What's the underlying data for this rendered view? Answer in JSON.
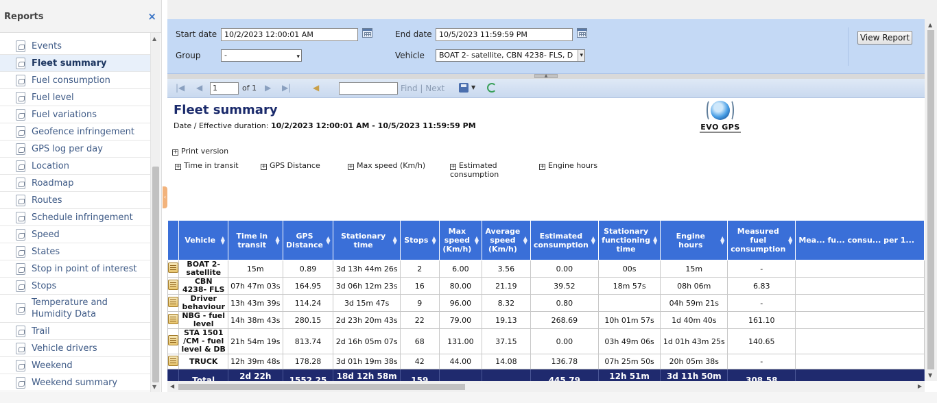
{
  "sidebar": {
    "title": "Reports",
    "close_glyph": "×",
    "items": [
      {
        "label": "Events",
        "active": false
      },
      {
        "label": "Fleet summary",
        "active": true
      },
      {
        "label": "Fuel consumption",
        "active": false
      },
      {
        "label": "Fuel level",
        "active": false
      },
      {
        "label": "Fuel variations",
        "active": false
      },
      {
        "label": "Geofence infringement",
        "active": false
      },
      {
        "label": "GPS log per day",
        "active": false
      },
      {
        "label": "Location",
        "active": false
      },
      {
        "label": "Roadmap",
        "active": false
      },
      {
        "label": "Routes",
        "active": false
      },
      {
        "label": "Schedule infringement",
        "active": false
      },
      {
        "label": "Speed",
        "active": false
      },
      {
        "label": "States",
        "active": false
      },
      {
        "label": "Stop in point of interest",
        "active": false
      },
      {
        "label": "Stops",
        "active": false
      },
      {
        "label": "Temperature and Humidity Data",
        "active": false
      },
      {
        "label": "Trail",
        "active": false
      },
      {
        "label": "Vehicle drivers",
        "active": false
      },
      {
        "label": "Weekend",
        "active": false
      },
      {
        "label": "Weekend summary",
        "active": false
      }
    ]
  },
  "params": {
    "start_label": "Start date",
    "start_value": "10/2/2023 12:00:01 AM",
    "end_label": "End date",
    "end_value": "10/5/2023 11:59:59 PM",
    "group_label": "Group",
    "group_value": "-",
    "vehicle_label": "Vehicle",
    "vehicle_value": "BOAT 2- satellite, CBN 4238- FLS, D",
    "view_button": "View Report"
  },
  "toolbar": {
    "page_value": "1",
    "of_text": "of 1",
    "find_label": "Find",
    "separator": "|",
    "next_label": "Next"
  },
  "report": {
    "title": "Fleet summary",
    "sub_label": "Date / Effective duration:",
    "sub_value": "10/2/2023 12:00:01 AM - 10/5/2023 11:59:59 PM",
    "logo_text": "EVO GPS",
    "print_version": "Print version",
    "toggles": [
      "Time in transit",
      "GPS Distance",
      "Max speed (Km/h)",
      "Estimated consumption",
      "Engine hours"
    ]
  },
  "table": {
    "headers": [
      "Vehicle",
      "Time in transit",
      "GPS Distance",
      "Stationary time",
      "Stops",
      "Max speed (Km/h)",
      "Average speed (Km/h)",
      "Estimated consumption",
      "Stationary functioning time",
      "Engine hours",
      "Measured fuel consumption",
      "Mea... fu... consu... per 1..."
    ],
    "rows": [
      [
        "BOAT 2- satellite",
        "15m",
        "0.89",
        "3d 13h 44m 26s",
        "2",
        "6.00",
        "3.56",
        "0.00",
        "00s",
        "15m",
        "-",
        ""
      ],
      [
        "CBN 4238- FLS",
        "07h 47m 03s",
        "164.95",
        "3d 06h 12m 23s",
        "16",
        "80.00",
        "21.19",
        "39.52",
        "18m 57s",
        "08h 06m",
        "6.83",
        ""
      ],
      [
        "Driver behaviour",
        "13h 43m 39s",
        "114.24",
        "3d 15m 47s",
        "9",
        "96.00",
        "8.32",
        "0.80",
        "",
        "04h 59m 21s",
        "-",
        ""
      ],
      [
        "NBG - fuel level",
        "14h 38m 43s",
        "280.15",
        "2d 23h 20m 43s",
        "22",
        "79.00",
        "19.13",
        "268.69",
        "10h 01m 57s",
        "1d 40m 40s",
        "161.10",
        ""
      ],
      [
        "STA 1501 /CM - fuel level & DB",
        "21h 54m 19s",
        "813.74",
        "2d 16h 05m 07s",
        "68",
        "131.00",
        "37.15",
        "0.00",
        "03h 49m 06s",
        "1d 01h 43m 25s",
        "140.65",
        ""
      ],
      [
        "TRUCK",
        "12h 39m 48s",
        "178.28",
        "3d 01h 19m 38s",
        "42",
        "44.00",
        "14.08",
        "136.78",
        "07h 25m 50s",
        "20h 05m 38s",
        "-",
        ""
      ]
    ],
    "total": [
      "Total",
      "2d 22h 58m 32s",
      "1552.25",
      "18d 12h 58m 04s",
      "159",
      "",
      "",
      "445.79",
      "12h 51m 32s",
      "3d 11h 50m 04s",
      "308.58",
      ""
    ]
  }
}
